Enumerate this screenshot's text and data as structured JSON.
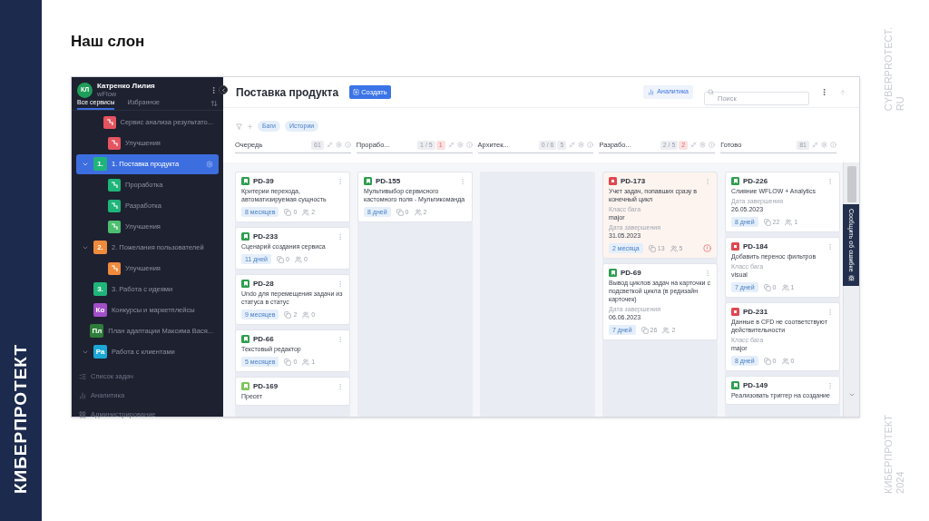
{
  "slide": {
    "title": "Наш слон",
    "brand_vertical": "КИБЕРПРОТЕКТ",
    "site_lines": [
      "CYBERPROTECT.",
      "RU"
    ],
    "footer_lines": [
      "КИБЕРПРОТЕКТ",
      "2024"
    ]
  },
  "sidebar": {
    "user": {
      "initials": "КЛ",
      "name": "Катренко Лилия",
      "workspace": "wFlow"
    },
    "tabs": [
      {
        "label": "Все сервисы",
        "selected": true
      },
      {
        "label": "Избранное",
        "selected": false
      }
    ],
    "tree": [
      {
        "children": [
          {
            "label": "Сервис анализа результато...",
            "color": "#e5545f",
            "selected": false
          },
          {
            "label": "Улучшения",
            "color": "#e5545f",
            "selected": false
          }
        ]
      },
      {
        "label": "1. Поставка продукта",
        "badge": "1.",
        "color": "#1fb57a",
        "selected": true,
        "expanded": true,
        "children": [
          {
            "label": "Проработка",
            "color": "#1fb57a",
            "selected": false
          },
          {
            "label": "Разработка",
            "color": "#1fb57a",
            "selected": false
          },
          {
            "label": "Улучшения",
            "color": "#4cbf6f",
            "selected": false
          }
        ]
      },
      {
        "label": "2. Пожелания пользователей",
        "badge": "2.",
        "color": "#f08a3c",
        "selected": false,
        "expanded": true,
        "children": [
          {
            "label": "Улучшения",
            "color": "#f08a3c",
            "selected": false
          }
        ]
      },
      {
        "label": "3. Работа с идеями",
        "badge": "3.",
        "color": "#1fb57a",
        "selected": false
      },
      {
        "label": "Конкурсы и маркетплейсы",
        "badge": "Ко",
        "color": "#a24fc9",
        "selected": false
      },
      {
        "label": "План адаптации Максима Вася...",
        "badge": "Пл",
        "color": "#2e7d3a",
        "selected": false
      },
      {
        "label": "Работа с клиентами",
        "badge": "Ра",
        "color": "#1aa7d6",
        "selected": false,
        "expanded": true
      }
    ],
    "footer": [
      {
        "label": "Список задач",
        "kind": "tasks"
      },
      {
        "label": "Аналитика",
        "kind": "analytics"
      },
      {
        "label": "Администрирование",
        "kind": "admin"
      }
    ]
  },
  "header": {
    "title": "Поставка продукта",
    "create_button": "Создать",
    "analytics_button": "Аналитика",
    "search": {
      "placeholder": "Поиск"
    }
  },
  "filters": {
    "chips": [
      "Баги",
      "Истории"
    ]
  },
  "columns": [
    {
      "title": "Очередь",
      "counts": [
        {
          "text": "61",
          "alert": false
        }
      ],
      "cards": [
        {
          "id": "PD-39",
          "kind": "story",
          "title": "Критерии перехода, автоматизируемая сущность",
          "age": "8 месяцев",
          "comments": "0",
          "people": "2",
          "overdue": false
        },
        {
          "id": "PD-233",
          "kind": "story",
          "title": "Сценарий создания сервиса",
          "age": "11 дней",
          "comments": "0",
          "people": "0",
          "overdue": false
        },
        {
          "id": "PD-28",
          "kind": "story",
          "title": "Undo для перемещения задачи из статуса в статус",
          "age": "9 месяцев",
          "comments": "2",
          "people": "0",
          "overdue": false
        },
        {
          "id": "PD-66",
          "kind": "story",
          "title": "Текстовый редактор",
          "age": "5 месяцев",
          "comments": "0",
          "people": "1",
          "overdue": false
        },
        {
          "id": "PD-169",
          "kind": "improvement",
          "title": "Пресет",
          "overdue": false
        }
      ]
    },
    {
      "title": "Прорабо...",
      "counts": [
        {
          "text": "1 / 5",
          "alert": false
        },
        {
          "text": "1",
          "alert": true
        }
      ],
      "cards": [
        {
          "id": "PD-155",
          "kind": "story",
          "title": "Мультивыбор сервисного кастомного поля - Мультикоманда",
          "age": "8 дней",
          "comments": "0",
          "people": "2",
          "overdue": false
        }
      ]
    },
    {
      "title": "Архитек...",
      "counts": [
        {
          "text": "0 / 6",
          "alert": false
        },
        {
          "text": "5",
          "alert": false
        }
      ]
    },
    {
      "title": "Разрабо...",
      "counts": [
        {
          "text": "2 / 5",
          "alert": false
        },
        {
          "text": "2",
          "alert": true
        }
      ],
      "cards": [
        {
          "id": "PD-173",
          "kind": "bug",
          "title": "Учет задач, попавших сразу в конечный цикл",
          "fields": [
            {
              "label": "Класс бага",
              "value": "major"
            },
            {
              "label": "Дата завершения",
              "value": "31.05.2023"
            }
          ],
          "age": "2 месяца",
          "comments": "13",
          "people": "5",
          "overdue": true
        },
        {
          "id": "PD-69",
          "kind": "story",
          "title": "Вывод циклов задач на карточки с подсветкой цикла (в редизайн карточек)",
          "fields": [
            {
              "label": "Дата завершения",
              "value": "06.06.2023"
            }
          ],
          "age": "7 дней",
          "comments": "26",
          "people": "2",
          "overdue": false
        }
      ]
    },
    {
      "title": "Готово",
      "counts": [
        {
          "text": "81",
          "alert": false
        }
      ],
      "cards": [
        {
          "id": "PD-226",
          "kind": "story",
          "title": "Слияние WFLOW + Analytics",
          "fields": [
            {
              "label": "Дата завершения",
              "value": "26.05.2023"
            }
          ],
          "age": "8 дней",
          "comments": "22",
          "people": "1",
          "overdue": false
        },
        {
          "id": "PD-184",
          "kind": "bug",
          "title": "Добавить перенос фильтров",
          "fields": [
            {
              "label": "Класс бага",
              "value": "visual"
            }
          ],
          "age": "7 дней",
          "comments": "0",
          "people": "1",
          "overdue": false
        },
        {
          "id": "PD-231",
          "kind": "bug",
          "title": "Данные в CFD не соответствуют действительности",
          "fields": [
            {
              "label": "Класс бага",
              "value": "major"
            }
          ],
          "age": "8 дней",
          "comments": "0",
          "people": "0",
          "overdue": false
        },
        {
          "id": "PD-149",
          "kind": "story",
          "title": "Реализовать триггер на создание",
          "overdue": false
        }
      ]
    }
  ],
  "feedback_tab": "Сообщить об ошибке"
}
